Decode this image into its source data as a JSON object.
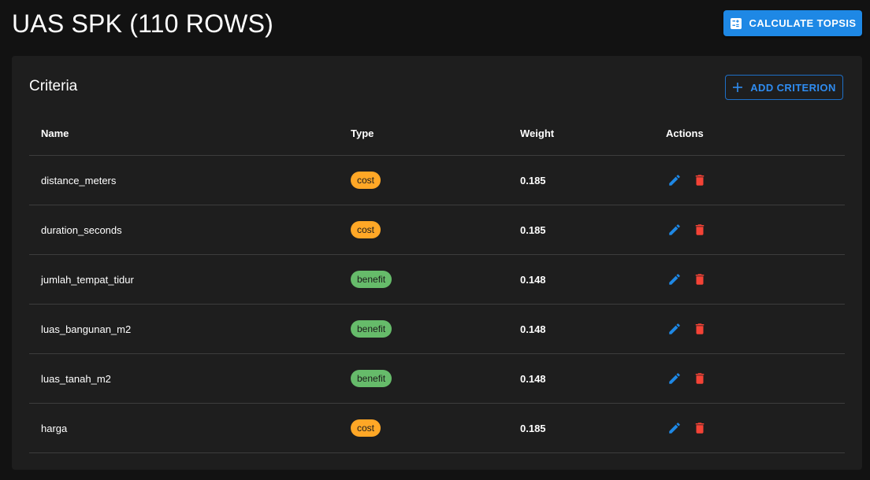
{
  "header": {
    "title": "UAS SPK (110 ROWS)",
    "calculate_label": "CALCULATE TOPSIS",
    "calculate_icon": "calculator-icon"
  },
  "card": {
    "title": "Criteria",
    "add_label": "ADD CRITERION",
    "add_icon": "plus-icon"
  },
  "table": {
    "columns": [
      "Name",
      "Type",
      "Weight",
      "Actions"
    ],
    "rows": [
      {
        "name": "distance_meters",
        "type": "cost",
        "weight": "0.185"
      },
      {
        "name": "duration_seconds",
        "type": "cost",
        "weight": "0.185"
      },
      {
        "name": "jumlah_tempat_tidur",
        "type": "benefit",
        "weight": "0.148"
      },
      {
        "name": "luas_bangunan_m2",
        "type": "benefit",
        "weight": "0.148"
      },
      {
        "name": "luas_tanah_m2",
        "type": "benefit",
        "weight": "0.148"
      },
      {
        "name": "harga",
        "type": "cost",
        "weight": "0.185"
      }
    ]
  },
  "colors": {
    "background": "#121212",
    "card": "#1e1e1e",
    "primary": "#1e88e5",
    "cost_chip": "#ffa726",
    "benefit_chip": "#66bb6a",
    "edit_icon": "#1e88e5",
    "delete_icon": "#f44336"
  },
  "icons": {
    "edit": "pencil-icon",
    "delete": "trash-icon"
  }
}
